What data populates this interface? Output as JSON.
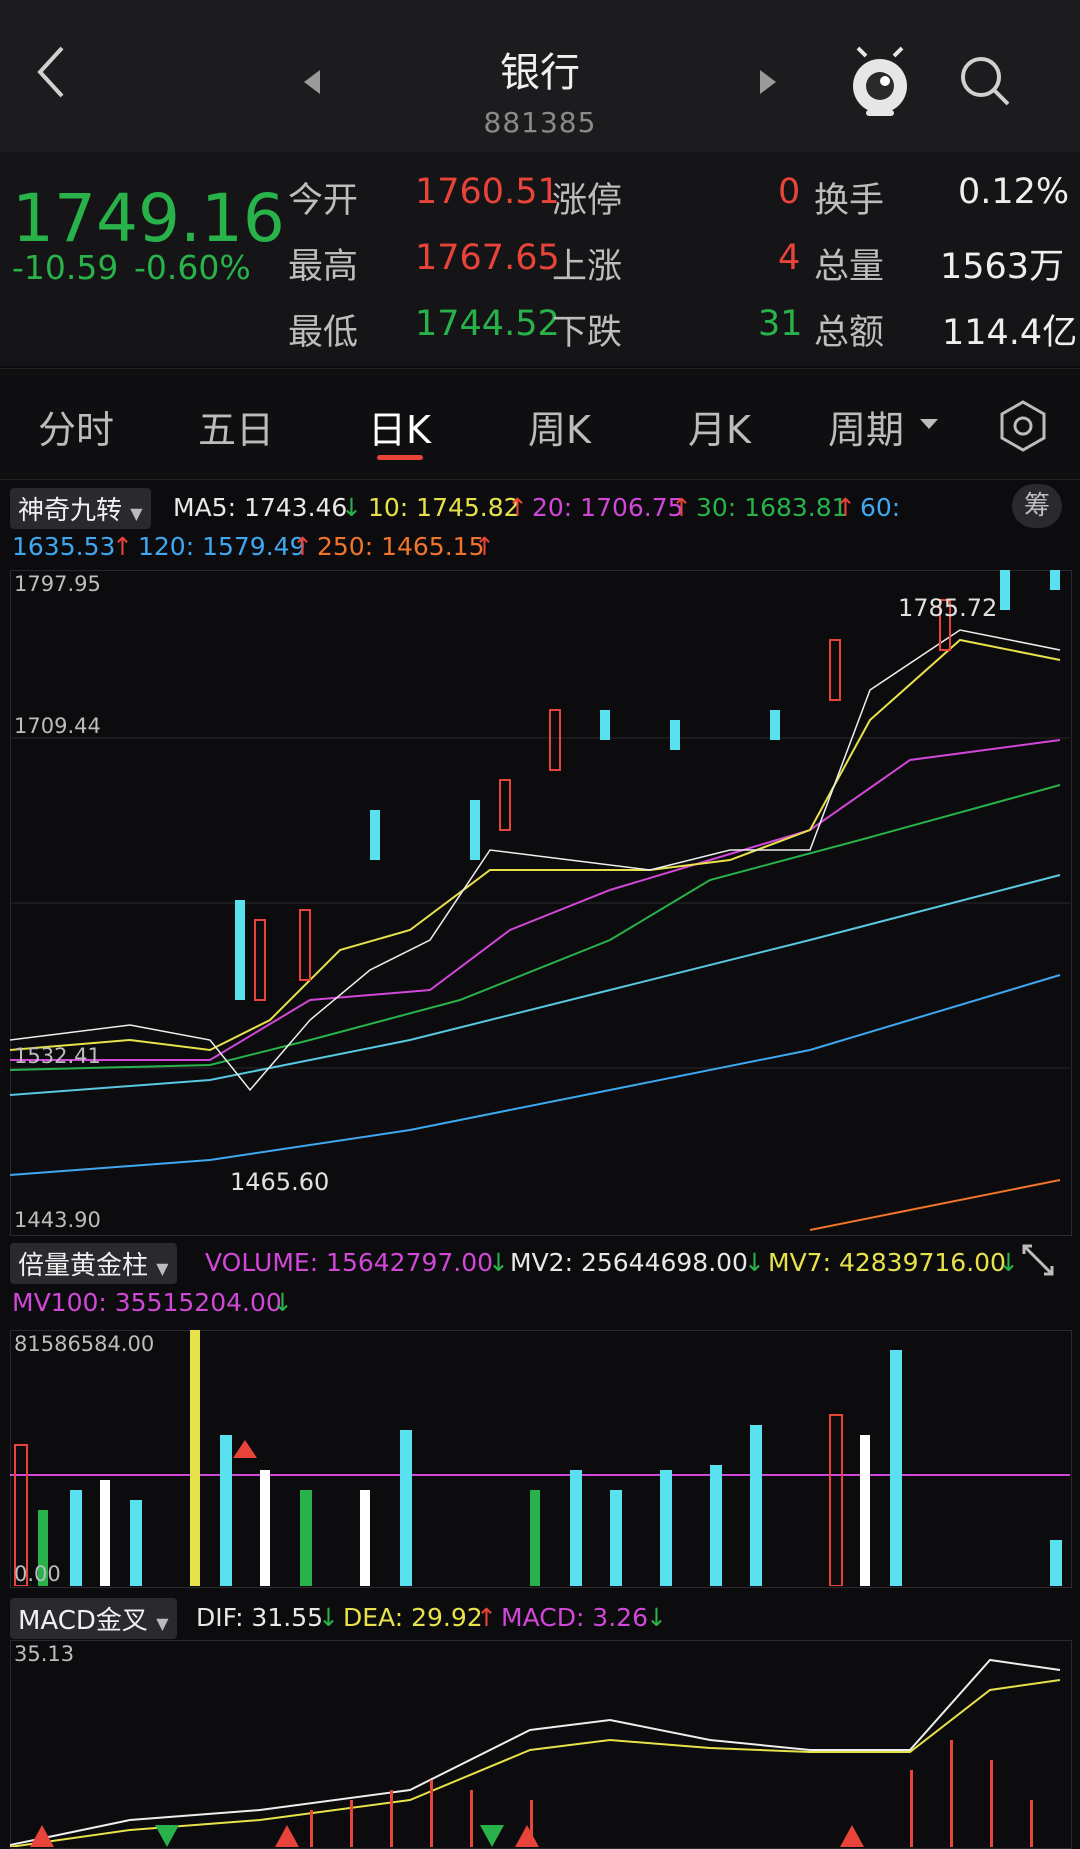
{
  "header": {
    "title": "银行",
    "code": "881385"
  },
  "quote": {
    "price": "1749.16",
    "change": "-10.59",
    "change_pct": "-0.60%",
    "rows": [
      {
        "l1": "今开",
        "v1": "1760.51",
        "l2": "涨停",
        "v2": "0",
        "l3": "换手",
        "v3": "0.12%"
      },
      {
        "l1": "最高",
        "v1": "1767.65",
        "l2": "上涨",
        "v2": "4",
        "l3": "总量",
        "v3": "1563万"
      },
      {
        "l1": "最低",
        "v1": "1744.52",
        "l2": "下跌",
        "v2": "31",
        "l3": "总额",
        "v3": "114.4亿"
      }
    ]
  },
  "tabs": [
    "分时",
    "五日",
    "日K",
    "周K",
    "月K",
    "周期"
  ],
  "active_tab": "日K",
  "kline": {
    "selector": "神奇九转",
    "ma5": "MA5: 1743.46",
    "ma10": "10: 1745.82",
    "ma20": "20: 1706.75",
    "ma30": "30: 1683.81",
    "ma60_label": "60:",
    "ma60_val": "1635.53",
    "ma120": "120: 1579.49",
    "ma250": "250: 1465.15",
    "badge": "筹",
    "y_top": "1797.95",
    "y_mid": "1709.44",
    "y_low": "1532.41",
    "y_bottom": "1443.90",
    "high_label": "1785.72",
    "low_label": "1465.60"
  },
  "volume": {
    "selector": "倍量黄金柱",
    "vol": "VOLUME: 15642797.00",
    "mv2": "MV2: 25644698.00",
    "mv7": "MV7: 42839716.00",
    "mv100": "MV100: 35515204.00",
    "y_top": "81586584.00",
    "y_bottom": "0.00"
  },
  "macd": {
    "selector": "MACD金叉",
    "dif": "DIF: 31.55",
    "dea": "DEA: 29.92",
    "macd": "MACD: 3.26",
    "y_top": "35.13"
  },
  "colors": {
    "up": "#e8443a",
    "down": "#29b24a",
    "cyan": "#59e1f0",
    "yellow": "#e8e24a",
    "magenta": "#d147d8",
    "blue": "#3fa8f0"
  },
  "icons": [
    "back-arrow-icon",
    "prev-triangle-icon",
    "next-triangle-icon",
    "robot-eye-icon",
    "search-icon",
    "settings-hexagon-icon",
    "expand-icon"
  ]
}
